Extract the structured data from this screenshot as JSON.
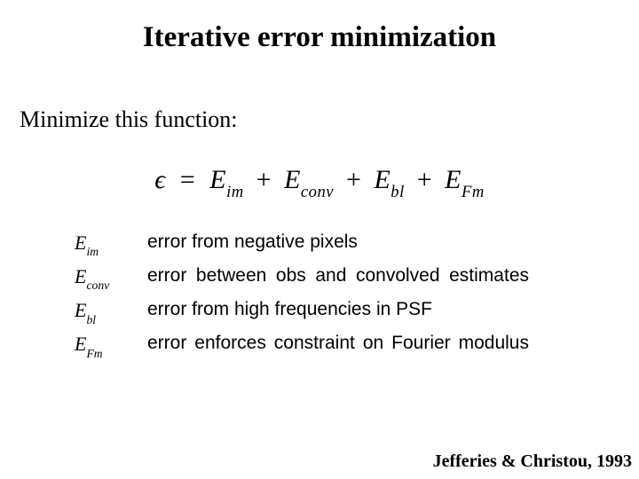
{
  "title": "Iterative error minimization",
  "subtitle": "Minimize this function:",
  "equation": {
    "eps": "ϵ",
    "E": "E",
    "sub_im": "im",
    "sub_conv": "conv",
    "sub_bl": "bl",
    "sub_Fm": "Fm"
  },
  "terms": [
    {
      "sub": "im",
      "desc": "error from negative pixels",
      "justify": false
    },
    {
      "sub": "conv",
      "desc": "error between obs and convolved estimates",
      "justify": true
    },
    {
      "sub": "bl",
      "desc": "error from high frequencies in PSF",
      "justify": false
    },
    {
      "sub": "Fm",
      "desc": "error enforces constraint on Fourier modulus",
      "justify": true
    }
  ],
  "citation": "Jefferies & Christou, 1993"
}
